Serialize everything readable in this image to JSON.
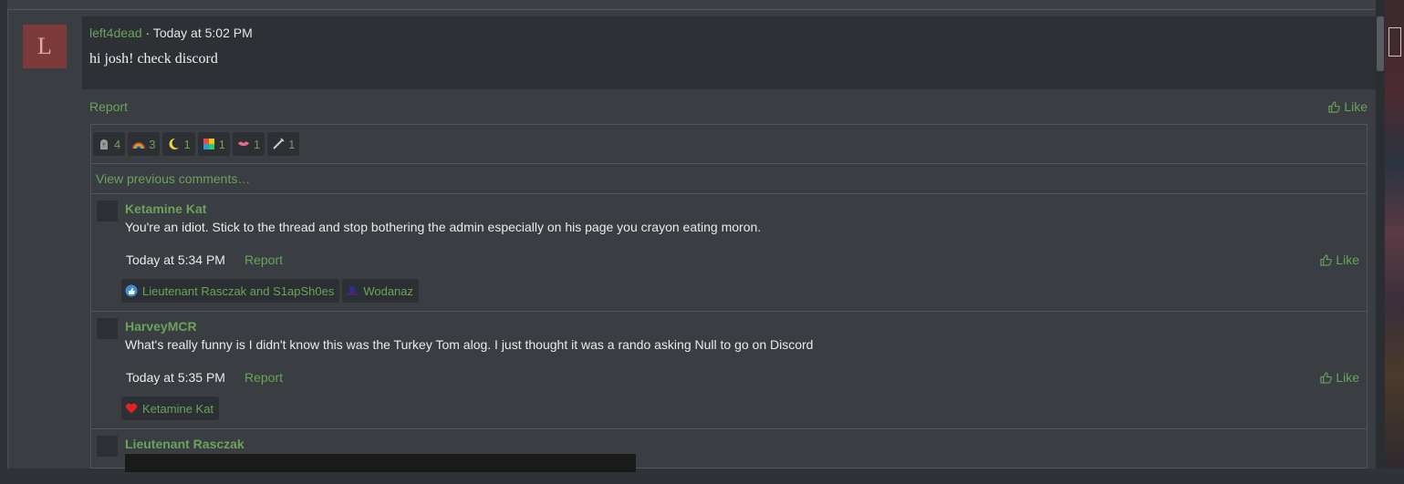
{
  "post": {
    "avatar_letter": "L",
    "author": "left4dead",
    "separator": "·",
    "timestamp": "Today at 5:02 PM",
    "message": "hi josh! check discord",
    "report_label": "Report",
    "like_label": "Like",
    "reactions": [
      {
        "icon": "tombstone-icon",
        "count": "4"
      },
      {
        "icon": "rainbow-icon",
        "count": "3"
      },
      {
        "icon": "moon-icon",
        "count": "1"
      },
      {
        "icon": "puzzle-icon",
        "count": "1"
      },
      {
        "icon": "lips-icon",
        "count": "1"
      },
      {
        "icon": "syringe-icon",
        "count": "1"
      }
    ]
  },
  "comments_section": {
    "view_previous": "View previous comments…",
    "comments": [
      {
        "author": "Ketamine Kat",
        "text": "You're an idiot. Stick to the thread and stop bothering the admin especially on his page you crayon eating moron.",
        "timestamp": "Today at 5:34 PM",
        "report_label": "Report",
        "like_label": "Like",
        "reactions": [
          {
            "icon": "thumbs-up-blue-icon",
            "label": "Lieutenant Rasczak and S1apSh0es"
          },
          {
            "icon": "top-hat-icon",
            "label": "Wodanaz"
          }
        ]
      },
      {
        "author": "HarveyMCR",
        "text": "What's really funny is I didn't know this was the Turkey Tom alog. I just thought it was a rando asking Null to go on Discord",
        "timestamp": "Today at 5:35 PM",
        "report_label": "Report",
        "like_label": "Like",
        "reactions": [
          {
            "icon": "heart-icon",
            "label": "Ketamine Kat"
          }
        ]
      },
      {
        "author": "Lieutenant Rasczak"
      }
    ]
  },
  "colors": {
    "accent_green": "#6aa35a",
    "background": "#3a3d42",
    "message_bg": "#2d3035",
    "avatar_bg": "#7c3a3a"
  }
}
